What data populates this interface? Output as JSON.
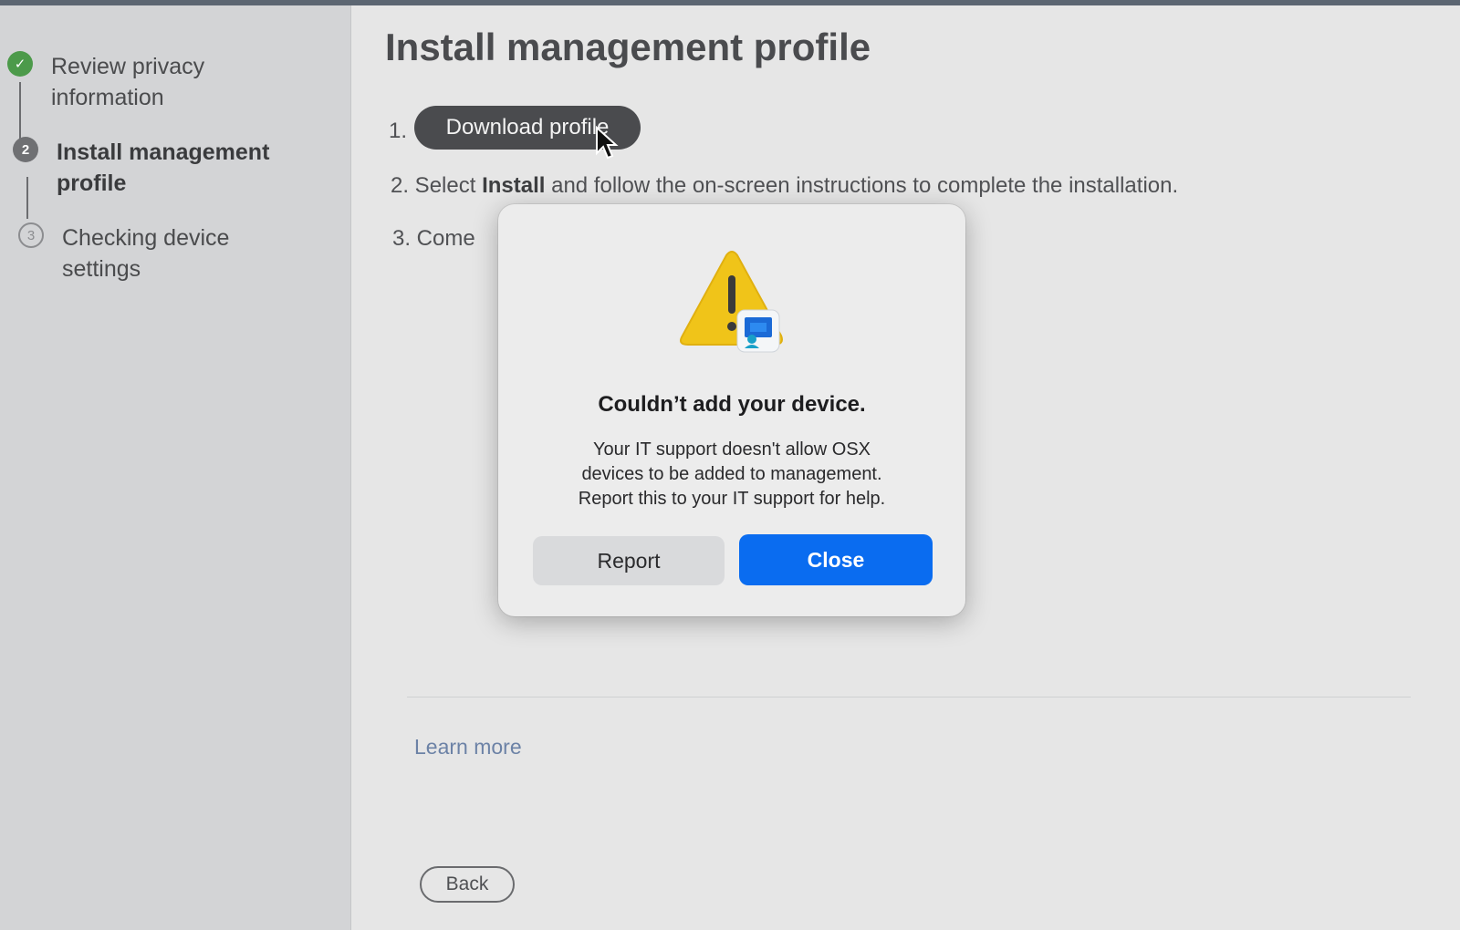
{
  "sidebar": {
    "steps": [
      {
        "label_line1": "Review privacy",
        "label_line2": "information",
        "state": "done",
        "marker": "✓"
      },
      {
        "label_line1": "Install management",
        "label_line2": "profile",
        "state": "current",
        "marker": "2"
      },
      {
        "label_line1": "Checking device",
        "label_line2": "settings",
        "state": "pending",
        "marker": "3"
      }
    ]
  },
  "main": {
    "title": "Install management profile",
    "step1_number": "1.",
    "download_button": "Download profile",
    "step2_prefix": "2. Select ",
    "step2_bold": "Install",
    "step2_suffix": " and follow the on-screen instructions to complete the installation.",
    "step3_text": "3. Come",
    "learn_more": "Learn more",
    "back_button": "Back"
  },
  "dialog": {
    "icon": "warning-device-icon",
    "title": "Couldn’t add your device.",
    "message_line1": "Your IT support doesn't allow OSX",
    "message_line2": "devices to be added to management.",
    "message_line3": "Report this to your IT support for help.",
    "report_button": "Report",
    "close_button": "Close"
  },
  "colors": {
    "accent": "#0a6cf0",
    "success": "#4c9a4a",
    "warning": "#f0c419"
  }
}
